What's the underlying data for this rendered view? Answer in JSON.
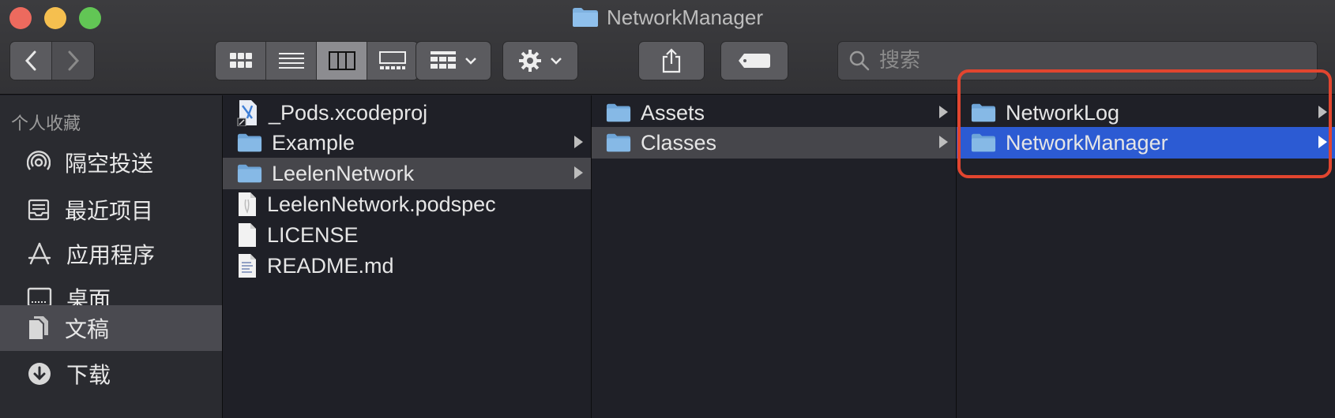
{
  "window": {
    "title": "NetworkManager"
  },
  "toolbar": {
    "search_placeholder": "搜索"
  },
  "sidebar": {
    "section": "个人收藏",
    "items": [
      {
        "label": "隔空投送",
        "icon": "airdrop-icon"
      },
      {
        "label": "最近项目",
        "icon": "recents-icon"
      },
      {
        "label": "应用程序",
        "icon": "applications-icon"
      },
      {
        "label": "桌面",
        "icon": "desktop-icon"
      },
      {
        "label": "文稿",
        "icon": "documents-icon"
      },
      {
        "label": "下载",
        "icon": "downloads-icon"
      }
    ]
  },
  "columns": {
    "first": [
      {
        "name": "_Pods.xcodeproj",
        "type": "xcodeproj"
      },
      {
        "name": "Example",
        "type": "folder"
      },
      {
        "name": "LeelenNetwork",
        "type": "folder"
      },
      {
        "name": "LeelenNetwork.podspec",
        "type": "file"
      },
      {
        "name": "LICENSE",
        "type": "file"
      },
      {
        "name": "README.md",
        "type": "text"
      }
    ],
    "second": [
      {
        "name": "Assets",
        "type": "folder"
      },
      {
        "name": "Classes",
        "type": "folder"
      }
    ],
    "third": [
      {
        "name": "NetworkLog",
        "type": "folder"
      },
      {
        "name": "NetworkManager",
        "type": "folder"
      }
    ]
  },
  "colors": {
    "selection_blue": "#2c5bd3",
    "annotation_red": "#e2452f",
    "folder_blue": "#7fb2e0"
  }
}
